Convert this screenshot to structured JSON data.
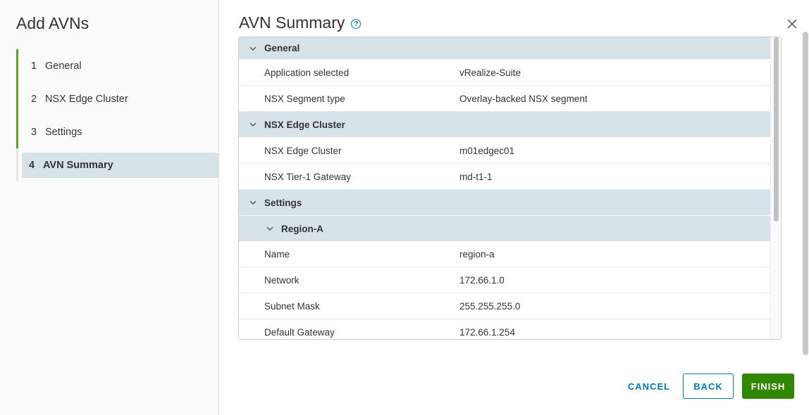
{
  "wizard": {
    "title": "Add AVNs",
    "steps": [
      {
        "num": "1",
        "label": "General"
      },
      {
        "num": "2",
        "label": "NSX Edge Cluster"
      },
      {
        "num": "3",
        "label": "Settings"
      },
      {
        "num": "4",
        "label": "AVN Summary"
      }
    ]
  },
  "main": {
    "title": "AVN Summary",
    "help_glyph": "?"
  },
  "summary": {
    "general": {
      "label": "General",
      "rows": [
        {
          "key": "Application selected",
          "value": "vRealize-Suite"
        },
        {
          "key": "NSX Segment type",
          "value": "Overlay-backed NSX segment"
        }
      ]
    },
    "edge": {
      "label": "NSX Edge Cluster",
      "rows": [
        {
          "key": "NSX Edge Cluster",
          "value": "m01edgec01"
        },
        {
          "key": "NSX Tier-1 Gateway",
          "value": "md-t1-1"
        }
      ]
    },
    "settings": {
      "label": "Settings",
      "region": {
        "label": "Region-A",
        "rows": [
          {
            "key": "Name",
            "value": "region-a"
          },
          {
            "key": "Network",
            "value": "172.66.1.0"
          },
          {
            "key": "Subnet Mask",
            "value": "255.255.255.0"
          },
          {
            "key": "Default Gateway",
            "value": "172.66.1.254"
          }
        ]
      }
    }
  },
  "buttons": {
    "cancel": "CANCEL",
    "back": "BACK",
    "finish": "FINISH"
  },
  "colors": {
    "accent": "#0079b8",
    "complete": "#62a420",
    "finish": "#318700",
    "section_bg": "#d8e3e9"
  }
}
